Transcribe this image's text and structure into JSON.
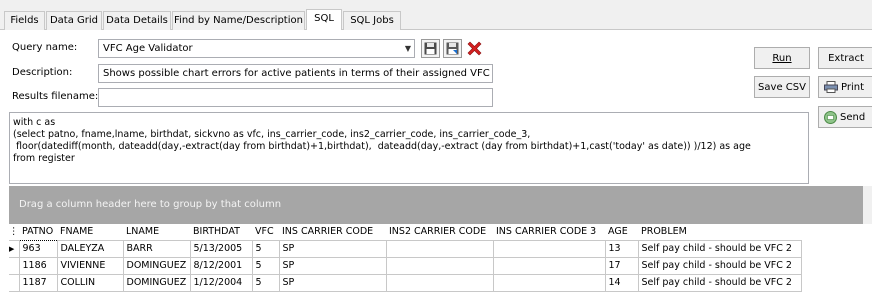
{
  "tabs": [
    {
      "label": "Fields",
      "active": false
    },
    {
      "label": "Data Grid",
      "active": false
    },
    {
      "label": "Data Details",
      "active": false
    },
    {
      "label": "Find by Name/Description",
      "active": false
    },
    {
      "label": "SQL",
      "active": true
    },
    {
      "label": "SQL Jobs",
      "active": false
    }
  ],
  "form": {
    "query_name_label": "Query name:",
    "query_name_value": "VFC Age Validator",
    "description_label": "Description:",
    "description_value": "Shows possible chart errors for active patients in terms of their assigned VFC statu",
    "results_filename_label": "Results filename:",
    "results_filename_value": ""
  },
  "buttons": {
    "run": "Run",
    "extract": "Extract",
    "save_csv": "Save CSV",
    "print": "Print",
    "send": "Send"
  },
  "sql_text": "with c as\n(select patno, fname,lname, birthdat, sickvno as vfc, ins_carrier_code, ins2_carrier_code, ins_carrier_code_3,\n floor(datediff(month, dateadd(day,-extract(day from birthdat)+1,birthdat),  dateadd(day,-extract (day from birthdat)+1,cast('today' as date)) )/12) as age\nfrom register",
  "grid": {
    "group_hint": "Drag a column header here to group by that column",
    "columns": [
      "PATNO",
      "FNAME",
      "LNAME",
      "BIRTHDAT",
      "VFC",
      "INS CARRIER CODE",
      "INS2 CARRIER CODE",
      "INS CARRIER CODE 3",
      "AGE",
      "PROBLEM"
    ],
    "rows": [
      [
        "963",
        "DALEYZA",
        "BARR",
        "5/13/2005",
        "5",
        "SP",
        "",
        "",
        "13",
        "Self pay child - should be VFC 2"
      ],
      [
        "1186",
        "VIVIENNE",
        "DOMINGUEZ",
        "8/12/2001",
        "5",
        "SP",
        "",
        "",
        "17",
        "Self pay child - should be VFC 2"
      ],
      [
        "1187",
        "COLLIN",
        "DOMINGUEZ",
        "1/12/2004",
        "5",
        "SP",
        "",
        "",
        "14",
        "Self pay child - should be VFC 2"
      ]
    ]
  },
  "colors": {
    "group_bar": "#a6a6a6",
    "delete_red": "#d42020"
  }
}
